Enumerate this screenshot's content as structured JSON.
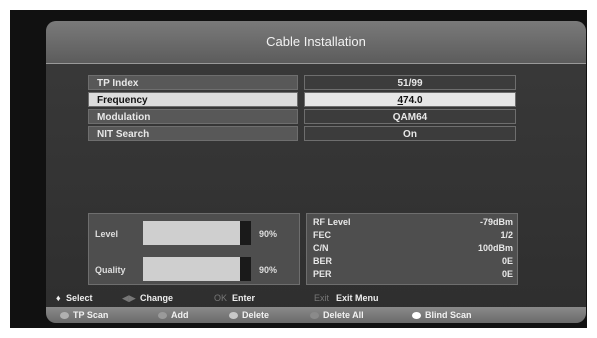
{
  "title": "Cable Installation",
  "rows": [
    {
      "label": "TP Index",
      "value": "51/99"
    },
    {
      "label": "Frequency",
      "value_first": "4",
      "value_rest": "74.0"
    },
    {
      "label": "Modulation",
      "value": "QAM64"
    },
    {
      "label": "NIT Search",
      "value": "On"
    }
  ],
  "signal": {
    "level_label": "Level",
    "level_value": "90%",
    "level_fraction": 0.9,
    "quality_label": "Quality",
    "quality_value": "90%",
    "quality_fraction": 0.9
  },
  "stats": [
    {
      "k": "RF Level",
      "v": "-79dBm"
    },
    {
      "k": "FEC",
      "v": "1/2"
    },
    {
      "k": "C/N",
      "v": "100dBm"
    },
    {
      "k": "BER",
      "v": "0E"
    },
    {
      "k": "PER",
      "v": "0E"
    }
  ],
  "help": {
    "select": "Select",
    "change": "Change",
    "ok_key": "OK",
    "enter": "Enter",
    "exit_key": "Exit",
    "exit_menu": "Exit Menu"
  },
  "buttons": {
    "tp_scan": "TP Scan",
    "add": "Add",
    "delete": "Delete",
    "delete_all": "Delete All",
    "blind_scan": "Blind Scan"
  },
  "colors": {
    "red": "#b0b0b0",
    "green": "#9a9a9a",
    "yellow": "#c8c8c8",
    "blue": "#8a8a8a",
    "white": "#ffffff"
  }
}
